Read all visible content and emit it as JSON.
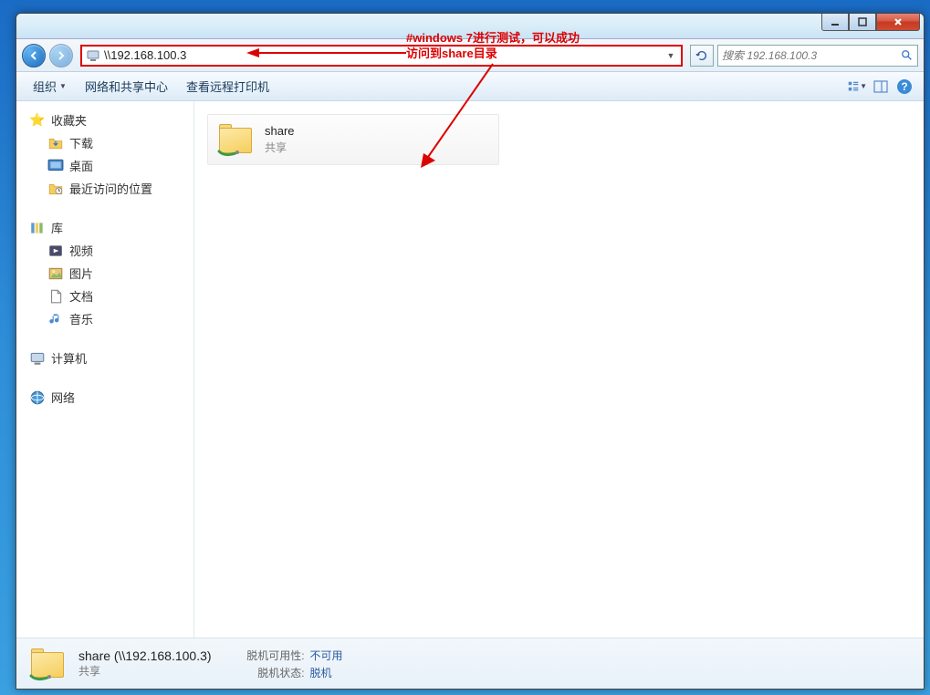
{
  "annotation": {
    "line1": "#windows 7进行测试，可以成功",
    "line2": "访问到share目录"
  },
  "address": "\\\\192.168.100.3",
  "search_placeholder": "搜索 192.168.100.3",
  "toolbar": {
    "organize": "组织",
    "network_center": "网络和共享中心",
    "view_printers": "查看远程打印机"
  },
  "sidebar": {
    "favorites": "收藏夹",
    "downloads": "下载",
    "desktop": "桌面",
    "recent": "最近访问的位置",
    "libraries": "库",
    "videos": "视频",
    "pictures": "图片",
    "documents": "文档",
    "music": "音乐",
    "computer": "计算机",
    "network": "网络"
  },
  "content": {
    "items": [
      {
        "name": "share",
        "subtitle": "共享"
      }
    ]
  },
  "details": {
    "title": "share (\\\\192.168.100.3)",
    "subtitle": "共享",
    "offline_avail_label": "脱机可用性:",
    "offline_avail_value": "不可用",
    "offline_status_label": "脱机状态:",
    "offline_status_value": "脱机"
  }
}
